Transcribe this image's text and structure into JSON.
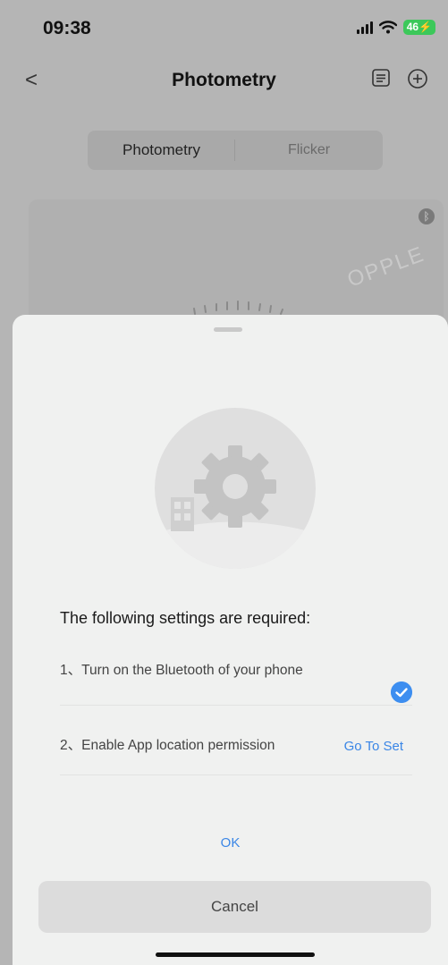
{
  "status_bar": {
    "time": "09:38",
    "battery": "46"
  },
  "header": {
    "back_label": "<",
    "title": "Photometry",
    "icons": [
      "document-icon",
      "plus-circle-icon"
    ]
  },
  "tabs": [
    {
      "label": "Photometry",
      "active": true
    },
    {
      "label": "Flicker",
      "active": false
    }
  ],
  "card": {
    "brand": "OPPLE"
  },
  "sheet": {
    "title": "The following settings are required:",
    "items": [
      {
        "label": "1、Turn on the Bluetooth of your phone",
        "status": "checked"
      },
      {
        "label": "2、Enable App location permission",
        "action": "Go To Set"
      }
    ],
    "ok_label": "OK",
    "cancel_label": "Cancel"
  },
  "colors": {
    "accent": "#3a86e6",
    "check": "#3d8ef0",
    "battery": "#3cc85a"
  }
}
